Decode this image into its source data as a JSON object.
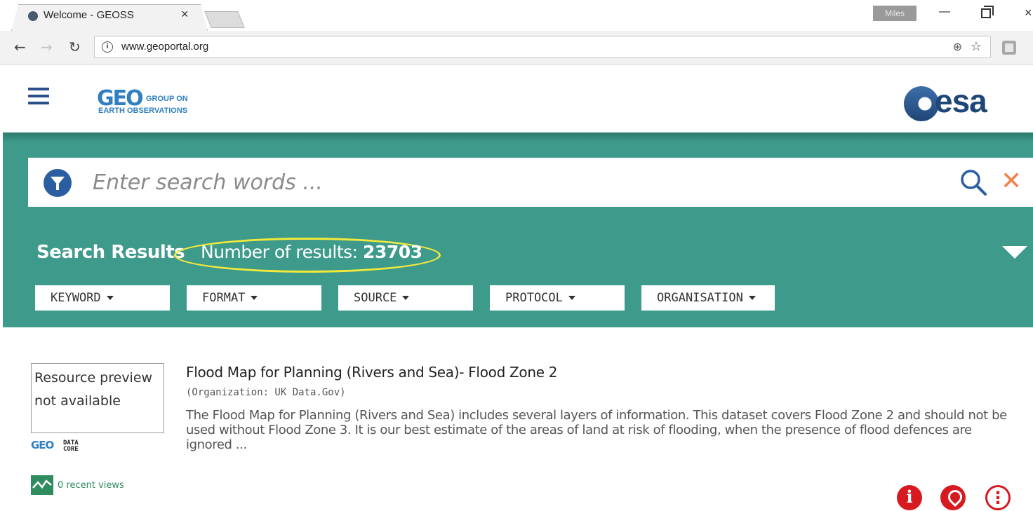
{
  "browser": {
    "tab_title": "Welcome - GEOSS",
    "tab_close": "×",
    "profile_name": "Miles",
    "url": "www.geoportal.org",
    "window_min": "—",
    "window_close": "×"
  },
  "header": {
    "geo_logo_mark": "GEO",
    "geo_logo_line1": "GROUP ON",
    "geo_logo_line2": "EARTH OBSERVATIONS",
    "esa_logo_text": "esa"
  },
  "search": {
    "placeholder": "Enter search words ...",
    "value": ""
  },
  "results": {
    "title": "Search Results",
    "count_label": "Number of results:",
    "count": "23703"
  },
  "facets": [
    {
      "label": "KEYWORD"
    },
    {
      "label": "FORMAT"
    },
    {
      "label": "SOURCE"
    },
    {
      "label": "PROTOCOL"
    },
    {
      "label": "ORGANISATION"
    }
  ],
  "result_item": {
    "preview_text": "Resource preview not available",
    "datacore_mark": "GEO",
    "datacore_text": "DATA CORE",
    "title": "Flood Map for Planning (Rivers and Sea)- Flood Zone 2",
    "organization": "(Organization: UK Data.Gov)",
    "description": "The Flood Map for Planning (Rivers and Sea) includes several layers of information. This dataset covers Flood Zone 2 and should not be used without Flood Zone 3. It is our best estimate of the areas of land at risk of flooding, when the presence of flood defences are ignored ...",
    "recent_views": "0 recent views"
  },
  "colors": {
    "band": "#3e9a8b",
    "brand_blue": "#2a5ea0",
    "highlight": "#f2ea3a",
    "action_red": "#d71920",
    "clear_orange": "#f0824a"
  }
}
